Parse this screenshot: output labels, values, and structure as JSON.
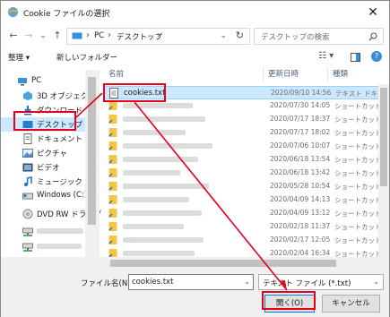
{
  "window": {
    "title": "Cookie ファイルの選択",
    "close_glyph": "✕"
  },
  "navigation": {
    "back_glyph": "←",
    "forward_glyph": "→",
    "recent_glyph": "⌄",
    "up_glyph": "↑",
    "address": [
      "PC",
      "デスクトップ"
    ],
    "address_sep": "›",
    "address_drop": "⌄",
    "refresh_glyph": "↻",
    "search_placeholder": "デスクトップの検索"
  },
  "toolbar": {
    "organize": "整理 ▾",
    "new_folder": "新しいフォルダー",
    "view_glyphs": "☷ ▾",
    "help_glyph": "?"
  },
  "nav_pane": {
    "items": [
      {
        "label": "PC",
        "icon": "pc-icon"
      },
      {
        "label": "3D オブジェクト",
        "icon": "3d-objects-icon"
      },
      {
        "label": "ダウンロード",
        "icon": "download-icon"
      },
      {
        "label": "デスクトップ",
        "icon": "desktop-icon",
        "selected": true
      },
      {
        "label": "ドキュメント",
        "icon": "documents-icon"
      },
      {
        "label": "ピクチャ",
        "icon": "pictures-icon"
      },
      {
        "label": "ビデオ",
        "icon": "videos-icon"
      },
      {
        "label": "ミュージック",
        "icon": "music-icon"
      },
      {
        "label": "Windows (C:)",
        "icon": "drive-icon"
      },
      {
        "label": "DVD RW ドライブ",
        "icon": "dvd-icon"
      },
      {
        "label": "",
        "icon": "network-drive-icon"
      },
      {
        "label": "",
        "icon": "network-drive-icon"
      },
      {
        "label": "",
        "icon": "network-drive-icon"
      },
      {
        "label": "DVD RW ドライブ (",
        "icon": "dvd-icon"
      }
    ]
  },
  "file_list": {
    "columns": {
      "name": "名前",
      "date": "更新日時",
      "type": "種類"
    },
    "rows": [
      {
        "name": "cookies.txt",
        "date": "2020/09/10 14:56",
        "type": "テキスト ドキ",
        "selected": true
      },
      {
        "name": "",
        "date": "2020/07/30 14:05",
        "type": "ショートカット"
      },
      {
        "name": "",
        "date": "2020/07/17 18:37",
        "type": "ショートカット"
      },
      {
        "name": "",
        "date": "2020/07/17 18:02",
        "type": "ショートカット"
      },
      {
        "name": "",
        "date": "2020/07/06 10:07",
        "type": "ショートカット"
      },
      {
        "name": "",
        "date": "2020/06/18 13:54",
        "type": "ショートカット"
      },
      {
        "name": "",
        "date": "2020/06/18 13:42",
        "type": "ショートカット"
      },
      {
        "name": "",
        "date": "2020/05/28 10:54",
        "type": "ショートカット"
      },
      {
        "name": "",
        "date": "2020/04/09 14:13",
        "type": "ショートカット"
      },
      {
        "name": "",
        "date": "2020/04/09 13:12",
        "type": "ショートカット"
      },
      {
        "name": "",
        "date": "2020/02/18 11:37",
        "type": "ショートカット"
      },
      {
        "name": "",
        "date": "2020/02/17 12:05",
        "type": "ショートカット"
      },
      {
        "name": "",
        "date": "2020/02/04 16:34",
        "type": "ショートカット"
      }
    ]
  },
  "footer": {
    "filename_label": "ファイル名(N):",
    "filename_value": "cookies.txt",
    "dropdown_glyph": "⌄",
    "file_type": "テキスト ファイル (*.txt)",
    "open_button": "開く(O)",
    "cancel_button": "キャンセル"
  },
  "colors": {
    "highlight": "#e6001e",
    "selection": "#cce8ff",
    "accent": "#0078d7"
  }
}
